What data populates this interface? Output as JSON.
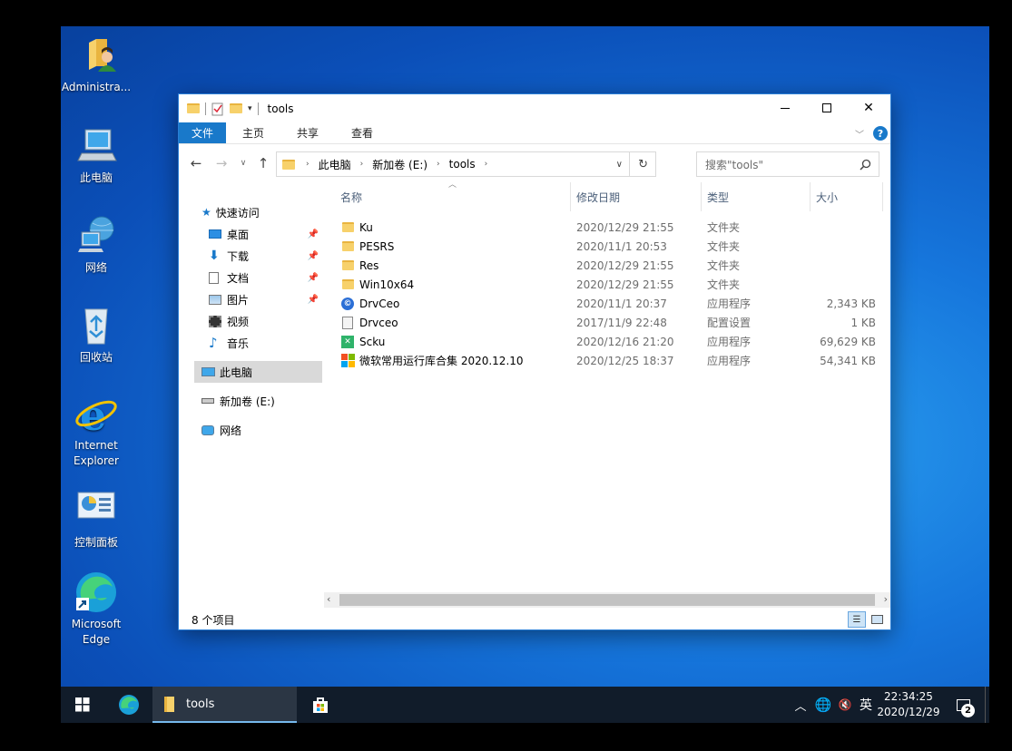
{
  "desktop": {
    "icons": [
      {
        "label": "Administra...",
        "icon": "user-folder-icon"
      },
      {
        "label": "此电脑",
        "icon": "computer-icon"
      },
      {
        "label": "网络",
        "icon": "network-icon"
      },
      {
        "label": "回收站",
        "icon": "recycle-bin-icon"
      },
      {
        "label": "Internet Explorer",
        "icon": "internet-explorer-icon"
      },
      {
        "label": "控制面板",
        "icon": "control-panel-icon"
      },
      {
        "label": "Microsoft Edge",
        "icon": "edge-icon"
      }
    ]
  },
  "window": {
    "title": "tools",
    "ribbon_tabs": [
      "文件",
      "主页",
      "共享",
      "查看"
    ],
    "breadcrumb": [
      "此电脑",
      "新加卷 (E:)",
      "tools"
    ],
    "search_placeholder": "搜索\"tools\"",
    "nav": {
      "quick_access": "快速访问",
      "pinned": [
        {
          "label": "桌面",
          "icon": "desktop-icon",
          "pinned": true
        },
        {
          "label": "下载",
          "icon": "download-icon",
          "pinned": true
        },
        {
          "label": "文档",
          "icon": "document-icon",
          "pinned": true
        },
        {
          "label": "图片",
          "icon": "pictures-icon",
          "pinned": true
        },
        {
          "label": "视频",
          "icon": "video-icon",
          "pinned": false
        },
        {
          "label": "音乐",
          "icon": "music-icon",
          "pinned": false
        }
      ],
      "this_pc": "此电脑",
      "drive": "新加卷 (E:)",
      "network": "网络"
    },
    "columns": [
      "名称",
      "修改日期",
      "类型",
      "大小"
    ],
    "files": [
      {
        "name": "Ku",
        "date": "2020/12/29 21:55",
        "type": "文件夹",
        "size": "",
        "icon": "folder-icon"
      },
      {
        "name": "PESRS",
        "date": "2020/11/1 20:53",
        "type": "文件夹",
        "size": "",
        "icon": "folder-icon"
      },
      {
        "name": "Res",
        "date": "2020/12/29 21:55",
        "type": "文件夹",
        "size": "",
        "icon": "folder-icon"
      },
      {
        "name": "Win10x64",
        "date": "2020/12/29 21:55",
        "type": "文件夹",
        "size": "",
        "icon": "folder-icon"
      },
      {
        "name": "DrvCeo",
        "date": "2020/11/1 20:37",
        "type": "应用程序",
        "size": "2,343 KB",
        "icon": "drvceo-app-icon"
      },
      {
        "name": "Drvceo",
        "date": "2017/11/9 22:48",
        "type": "配置设置",
        "size": "1 KB",
        "icon": "config-file-icon"
      },
      {
        "name": "Scku",
        "date": "2020/12/16 21:20",
        "type": "应用程序",
        "size": "69,629 KB",
        "icon": "scku-app-icon"
      },
      {
        "name": "微软常用运行库合集 2020.12.10",
        "date": "2020/12/25 18:37",
        "type": "应用程序",
        "size": "54,341 KB",
        "icon": "windows-logo-icon"
      }
    ],
    "status": "8 个项目"
  },
  "taskbar": {
    "active_app": "tools",
    "ime": "英",
    "time": "22:34:25",
    "date": "2020/12/29",
    "notifications": "2"
  },
  "colors": {
    "accent": "#1979ca",
    "taskbar": "#111c2a",
    "folder": "#f7d16b"
  }
}
